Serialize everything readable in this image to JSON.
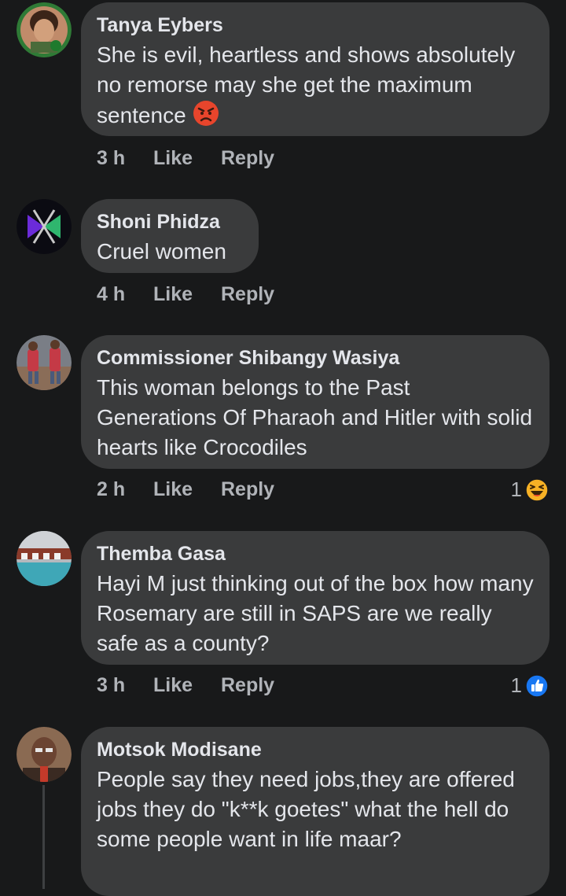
{
  "comments": [
    {
      "author": "Tanya Eybers",
      "text": "She is evil, heartless and shows absolutely no remorse may she get the maximum sentence",
      "time": "3 h",
      "like": "Like",
      "reply": "Reply",
      "inline_emoji": "angry-face-icon"
    },
    {
      "author": "Shoni Phidza",
      "text": "Cruel women",
      "time": "4 h",
      "like": "Like",
      "reply": "Reply"
    },
    {
      "author": "Commissioner Shibangy Wasiya",
      "text": "This woman belongs to the Past Generations Of Pharaoh and Hitler with solid hearts like Crocodiles",
      "time": "2 h",
      "like": "Like",
      "reply": "Reply",
      "reaction": {
        "count": "1",
        "icon": "haha-reaction-icon"
      }
    },
    {
      "author": "Themba Gasa",
      "text": "Hayi M just thinking out of the box how many Rosemary are still in SAPS are we really safe as a county?",
      "time": "3 h",
      "like": "Like",
      "reply": "Reply",
      "reaction": {
        "count": "1",
        "icon": "like-reaction-icon"
      }
    },
    {
      "author": "Motsok Modisane",
      "text": "People say they need jobs,they are offered jobs they do \"k**k goetes\" what the hell do some people want in life maar?"
    }
  ],
  "colors": {
    "background": "#18191a",
    "bubble": "#3a3b3c",
    "primary_text": "#e4e6eb",
    "secondary_text": "#b0b3b8",
    "like_blue": "#1877f2",
    "haha_yellow": "#f7b125"
  }
}
